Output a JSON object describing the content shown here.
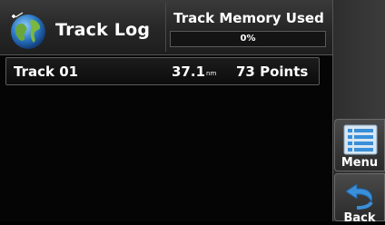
{
  "header": {
    "title": "Track Log",
    "icon": "globe-track-icon"
  },
  "memory": {
    "label": "Track Memory Used",
    "percent_text": "0%",
    "percent": 0
  },
  "tracks": [
    {
      "name": "Track 01",
      "distance": "37.1",
      "unit": "nm",
      "points": "73 Points"
    }
  ],
  "softkeys": {
    "menu": {
      "label": "Menu",
      "icon": "menu-list-icon"
    },
    "back": {
      "label": "Back",
      "icon": "back-arrow-icon"
    }
  },
  "colors": {
    "accent_blue": "#3a8fd8",
    "background": "#050505"
  }
}
